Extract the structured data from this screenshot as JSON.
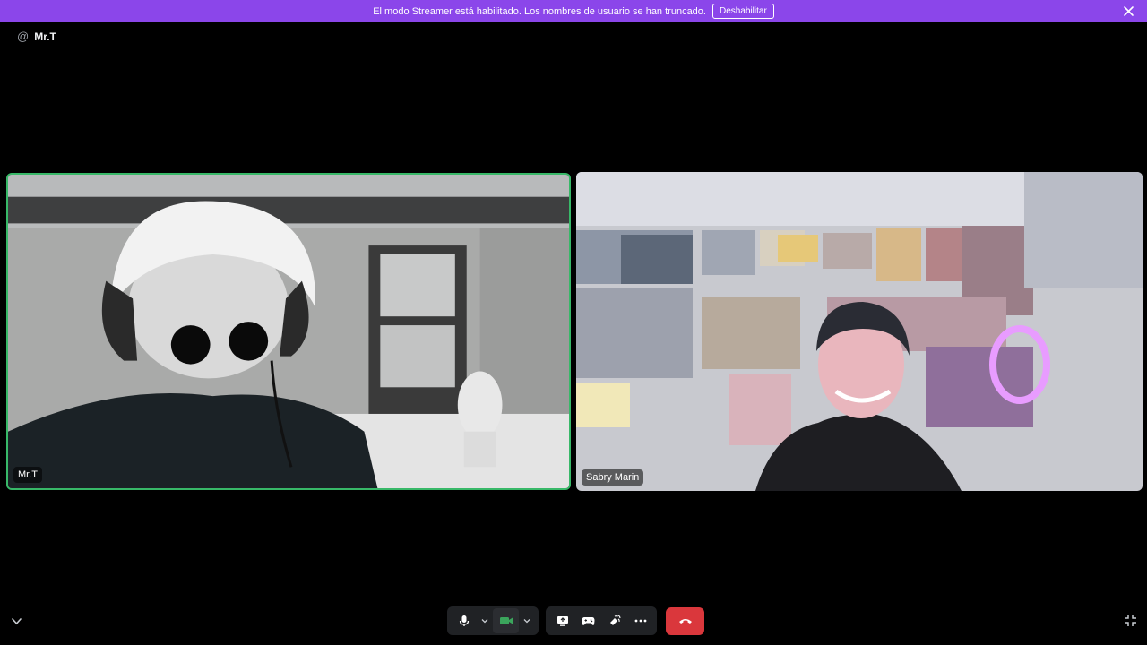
{
  "banner": {
    "text": "El modo Streamer está habilitado. Los nombres de usuario se han truncado.",
    "button_label": "Deshabilitar"
  },
  "channel": {
    "at": "@",
    "name": "Mr.T"
  },
  "participants": [
    {
      "name": "Mr.T",
      "speaking": true
    },
    {
      "name": "Sabry Marin",
      "speaking": false
    }
  ],
  "controls": {
    "icons": [
      "microphone-icon",
      "chevron-down-icon",
      "camera-icon",
      "chevron-down-icon",
      "screen-share-icon",
      "gamepad-icon",
      "soundboard-icon",
      "more-icon",
      "hang-up-icon"
    ]
  },
  "colors": {
    "banner": "#8b46ea",
    "speaking_border": "#38b868",
    "hangup": "#da373c",
    "camera_on": "#3ba55c"
  }
}
